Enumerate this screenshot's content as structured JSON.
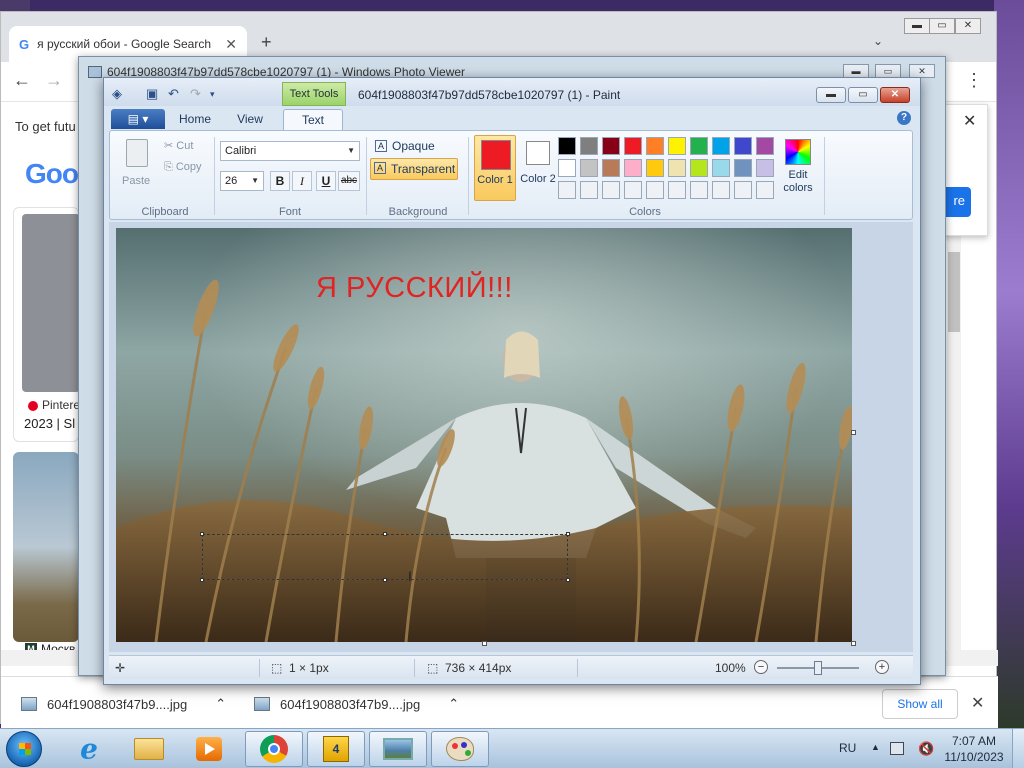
{
  "chrome": {
    "tab_title": "я русский обои - Google Search",
    "tab_favicon": "G",
    "banner_text": "To get futu",
    "google_logo": "Goo",
    "results": [
      {
        "source": "Pintere",
        "subtitle": "2023 | Sl"
      },
      {
        "source": "Москв",
        "badge": "M"
      }
    ],
    "popup_button": "re",
    "downloads": [
      {
        "name": "604f1908803f47b9....jpg"
      },
      {
        "name": "604f1908803f47b9....jpg"
      }
    ],
    "show_all": "Show all"
  },
  "photo_viewer": {
    "title": "604f1908803f47b97dd578cbe1020797 (1) - Windows Photo Viewer"
  },
  "paint": {
    "contextual_tab": "Text Tools",
    "title": "604f1908803f47b97dd578cbe1020797 (1) - Paint",
    "tabs": [
      "Home",
      "View",
      "Text"
    ],
    "active_tab": "Text",
    "clipboard": {
      "paste": "Paste",
      "cut": "Cut",
      "copy": "Copy",
      "label": "Clipboard"
    },
    "font": {
      "name": "Calibri",
      "size": "26",
      "label": "Font",
      "bold": "B",
      "italic": "I",
      "underline": "U",
      "strike": "abc"
    },
    "background": {
      "opaque": "Opaque",
      "transparent": "Transparent",
      "label": "Background"
    },
    "colors": {
      "color1": "Color 1",
      "color2": "Color 2",
      "edit": "Edit colors",
      "label": "Colors",
      "color1_value": "#ed1c24",
      "color2_value": "#ffffff",
      "palette_row1": [
        "#000000",
        "#7f7f7f",
        "#880015",
        "#ed1c24",
        "#ff7f27",
        "#fff200",
        "#22b14c",
        "#00a2e8",
        "#3f48cc",
        "#a349a4"
      ],
      "palette_row2": [
        "#ffffff",
        "#c3c3c3",
        "#b97a57",
        "#ffaec9",
        "#ffc90e",
        "#efe4b0",
        "#b5e61d",
        "#99d9ea",
        "#7092be",
        "#c8bfe7"
      ]
    },
    "canvas_text": "Я РУССКИЙ!!!",
    "status": {
      "selection": "1 × 1px",
      "image_size": "736 × 414px",
      "zoom": "100%"
    },
    "zoom_percent": 100
  },
  "taskbar": {
    "language": "RU",
    "time": "7:07 AM",
    "date": "11/10/2023"
  },
  "icons": {
    "back": "arrow-left-icon",
    "forward": "arrow-right-icon",
    "menu": "kebab-menu-icon"
  }
}
